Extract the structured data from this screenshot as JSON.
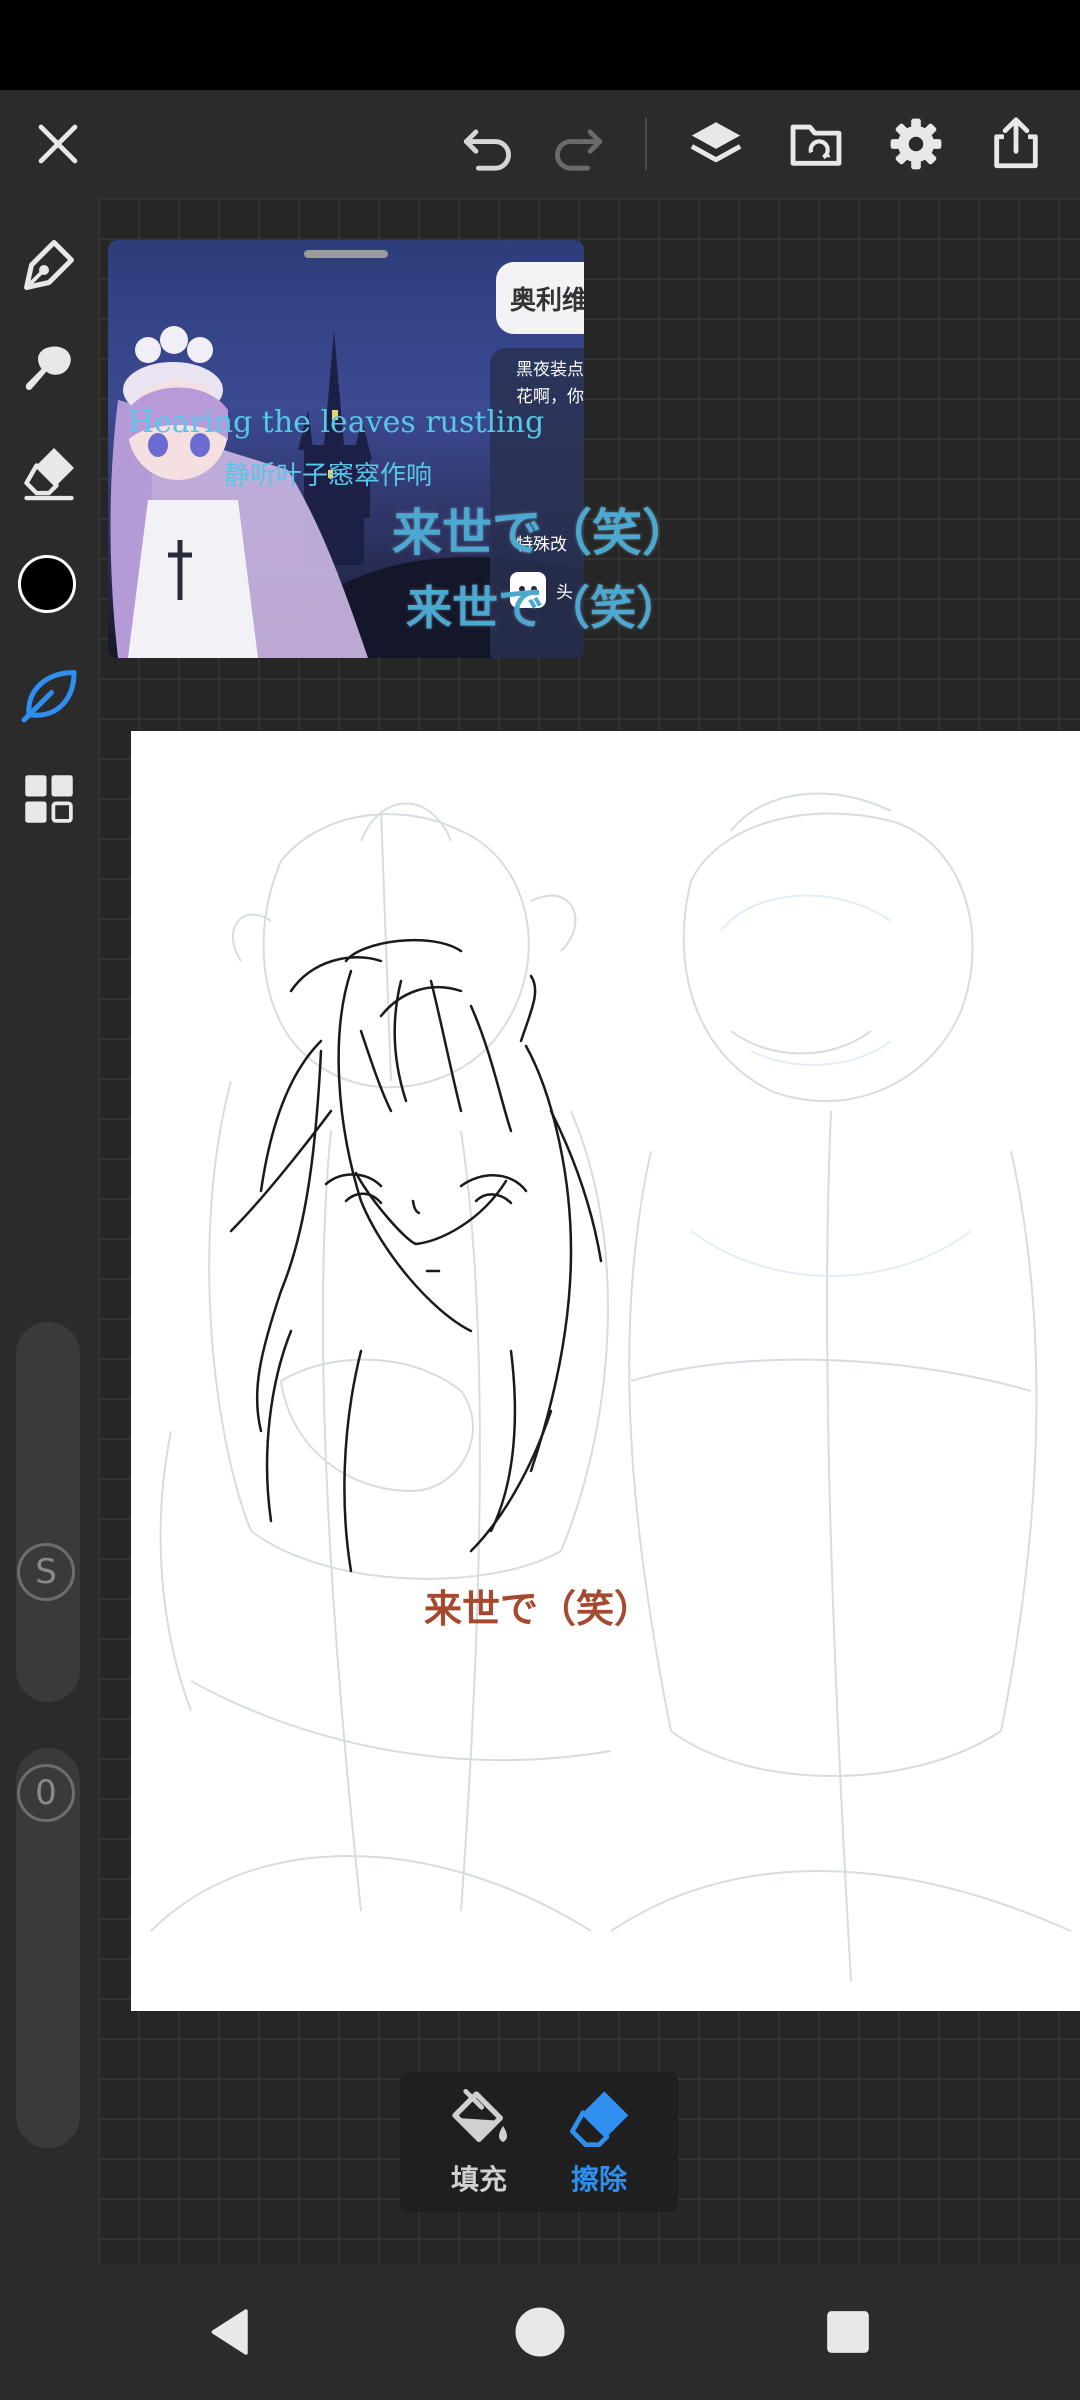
{
  "app": {
    "colors": {
      "accent": "#2e8ff0",
      "icon": "#e8e8e8",
      "toolbar_bg": "#2b2b2b",
      "brush_color": "#000000"
    }
  },
  "top_toolbar": {
    "icons": [
      "close-icon",
      "undo-icon",
      "redo-icon",
      "layers-icon",
      "import-icon",
      "settings-icon",
      "share-icon"
    ]
  },
  "left_toolbar": {
    "tools": [
      "pen-icon",
      "smudge-icon",
      "eraser-icon",
      "color-swatch",
      "leaf-brush-icon",
      "grid-icon"
    ],
    "size_slider_label": "S",
    "opacity_slider_label": "0"
  },
  "reference_window": {
    "chip_text": "奥利维",
    "panel_line_1": "黑夜装点",
    "panel_line_2": "花啊，你",
    "panel_line_3": "特殊改",
    "panel_line_4": "头",
    "lyric_en": "Hearing the leaves rustling",
    "lyric_zh": "静听叶子窸窣作响"
  },
  "subtitles": {
    "line_1": "来世で（笑）",
    "line_2": "来世で（笑）",
    "paper_line": "来世で（笑）"
  },
  "bottom_panel": {
    "fill_label": "填充",
    "erase_label": "擦除",
    "selected": "erase"
  },
  "nav_bar": {
    "icons": [
      "back-icon",
      "home-icon",
      "recents-icon"
    ]
  }
}
